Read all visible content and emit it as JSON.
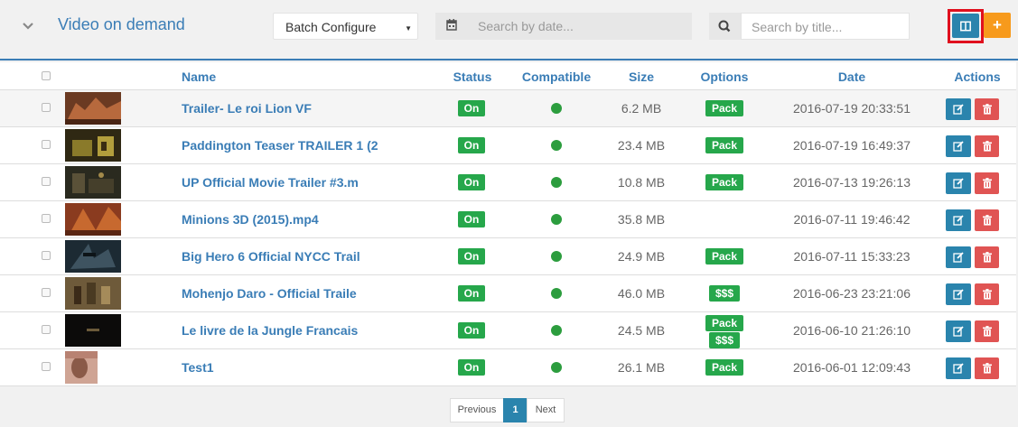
{
  "header": {
    "title": "Video on demand",
    "batch_select": "Batch Configure",
    "date_placeholder": "Search by date...",
    "title_placeholder": "Search by title...",
    "add_label": "+"
  },
  "table": {
    "columns": [
      "Name",
      "Status",
      "Compatible",
      "Size",
      "Options",
      "Date",
      "Actions"
    ],
    "rows": [
      {
        "name": "Trailer- Le roi Lion VF",
        "status": "On",
        "size": "6.2 MB",
        "options": [
          "Pack"
        ],
        "date": "2016-07-19 20:33:51"
      },
      {
        "name": "Paddington Teaser TRAILER 1 (2",
        "status": "On",
        "size": "23.4 MB",
        "options": [
          "Pack"
        ],
        "date": "2016-07-19 16:49:37"
      },
      {
        "name": "UP Official Movie Trailer #3.m",
        "status": "On",
        "size": "10.8 MB",
        "options": [
          "Pack"
        ],
        "date": "2016-07-13 19:26:13"
      },
      {
        "name": "Minions 3D (2015).mp4",
        "status": "On",
        "size": "35.8 MB",
        "options": [],
        "date": "2016-07-11 19:46:42"
      },
      {
        "name": "Big Hero 6 Official NYCC Trail",
        "status": "On",
        "size": "24.9 MB",
        "options": [
          "Pack"
        ],
        "date": "2016-07-11 15:33:23"
      },
      {
        "name": "Mohenjo Daro - Official Traile",
        "status": "On",
        "size": "46.0 MB",
        "options": [
          "$$$"
        ],
        "date": "2016-06-23 23:21:06"
      },
      {
        "name": "Le livre de la Jungle Francais",
        "status": "On",
        "size": "24.5 MB",
        "options": [
          "Pack",
          "$$$"
        ],
        "date": "2016-06-10 21:26:10"
      },
      {
        "name": "Test1",
        "status": "On",
        "size": "26.1 MB",
        "options": [
          "Pack"
        ],
        "date": "2016-06-01 12:09:43"
      }
    ]
  },
  "pagination": {
    "previous": "Previous",
    "current": "1",
    "next": "Next"
  },
  "colors": {
    "accent": "#3a7db6",
    "success": "#26a74b",
    "danger": "#e05453",
    "warning": "#f79a1c",
    "highlight": "#e0101e"
  },
  "icons": [
    "chevron-down-icon",
    "calendar-icon",
    "search-icon",
    "columns-icon",
    "plus-icon",
    "edit-icon",
    "trash-icon"
  ]
}
